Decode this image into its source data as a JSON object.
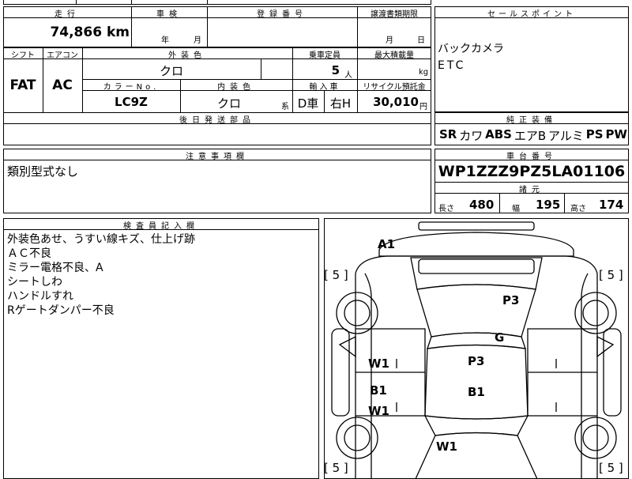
{
  "header": {
    "mileage_label": "走行",
    "mileage_value": "74,866",
    "mileage_unit": "km",
    "inspection_label": "車検",
    "inspection_year_unit": "年",
    "inspection_month_unit": "月",
    "registration_label": "登録番号",
    "transfer_label": "譲渡書類期限",
    "transfer_month_unit": "月",
    "transfer_day_unit": "日",
    "sales_label": "セールスポイント"
  },
  "sales_points": [
    "バックカメラ",
    "ETC"
  ],
  "spec": {
    "shift_label": "シフト",
    "shift_value": "FAT",
    "ac_label": "エアコン",
    "ac_value": "AC",
    "exterior_label": "外装色",
    "exterior_value": "クロ",
    "capacity_label": "乗車定員",
    "capacity_value": "5",
    "capacity_unit": "人",
    "load_label": "最大積載量",
    "load_unit": "kg",
    "colorno_label": "カラーNo.",
    "colorno_value": "LC9Z",
    "interior_label": "内装色",
    "interior_value": "クロ",
    "interior_unit": "系",
    "import_label": "輸入車",
    "import_value_1": "D車",
    "import_value_2": "右H",
    "recycle_label": "リサイクル預託金",
    "recycle_value": "30,010",
    "recycle_unit": "円",
    "later_label": "後日発送部品"
  },
  "equipment": {
    "label": "純正装備",
    "items": [
      "SR",
      "カワ",
      "ABS",
      "エアB",
      "アルミ",
      "PS",
      "PW"
    ]
  },
  "caution": {
    "label": "注意事項欄",
    "text": "類別型式なし"
  },
  "chassis": {
    "label": "車台番号",
    "value": "WP1ZZZ9PZ5LA01106"
  },
  "dimensions": {
    "label": "諸元",
    "length_label": "長さ",
    "length_value": "480",
    "width_label": "幅",
    "width_value": "195",
    "height_label": "高さ",
    "height_value": "174"
  },
  "inspector": {
    "label": "検査員記入欄",
    "notes": [
      "外装色あせ、うすい線キズ、仕上げ跡",
      "ＡＣ不良",
      "ミラー電格不良、A",
      "シートしわ",
      "ハンドルすれ",
      "Rゲートダンパー不良"
    ]
  },
  "diagram": {
    "marks": [
      "A1",
      "P3",
      "G",
      "W1",
      "P3",
      "B1",
      "B1",
      "W1",
      "W1"
    ],
    "tires": [
      "[ 5 ]",
      "[ 5 ]",
      "[ 5 ]",
      "[ 5 ]"
    ]
  }
}
